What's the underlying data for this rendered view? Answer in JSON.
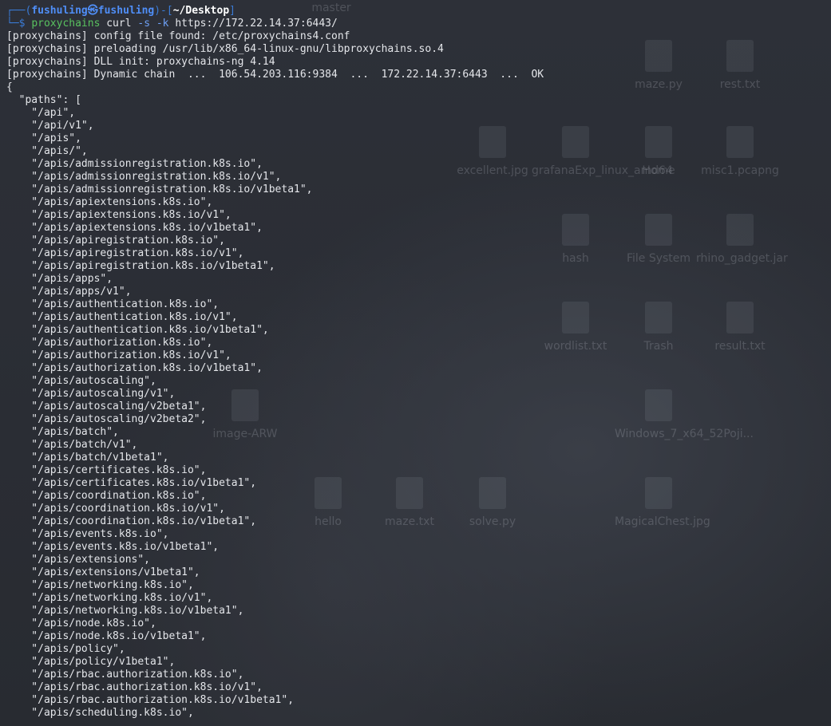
{
  "prompt": {
    "frame_open": "┌──(",
    "user": "fushuling",
    "at_symbol": "㉿",
    "host": "fushuling",
    "frame_mid": ")-[",
    "cwd": "~/Desktop",
    "frame_close": "]",
    "frame_cmd": "└─$ ",
    "command": "proxychains",
    "args_pre": " curl ",
    "flags": "-s -k",
    "url": " https://172.22.14.37:6443/"
  },
  "output_lines": [
    "[proxychains] config file found: /etc/proxychains4.conf",
    "[proxychains] preloading /usr/lib/x86_64-linux-gnu/libproxychains.so.4",
    "[proxychains] DLL init: proxychains-ng 4.14",
    "[proxychains] Dynamic chain  ...  106.54.203.116:9384  ...  172.22.14.37:6443  ...  OK",
    "{",
    "  \"paths\": [",
    "    \"/api\",",
    "    \"/api/v1\",",
    "    \"/apis\",",
    "    \"/apis/\",",
    "    \"/apis/admissionregistration.k8s.io\",",
    "    \"/apis/admissionregistration.k8s.io/v1\",",
    "    \"/apis/admissionregistration.k8s.io/v1beta1\",",
    "    \"/apis/apiextensions.k8s.io\",",
    "    \"/apis/apiextensions.k8s.io/v1\",",
    "    \"/apis/apiextensions.k8s.io/v1beta1\",",
    "    \"/apis/apiregistration.k8s.io\",",
    "    \"/apis/apiregistration.k8s.io/v1\",",
    "    \"/apis/apiregistration.k8s.io/v1beta1\",",
    "    \"/apis/apps\",",
    "    \"/apis/apps/v1\",",
    "    \"/apis/authentication.k8s.io\",",
    "    \"/apis/authentication.k8s.io/v1\",",
    "    \"/apis/authentication.k8s.io/v1beta1\",",
    "    \"/apis/authorization.k8s.io\",",
    "    \"/apis/authorization.k8s.io/v1\",",
    "    \"/apis/authorization.k8s.io/v1beta1\",",
    "    \"/apis/autoscaling\",",
    "    \"/apis/autoscaling/v1\",",
    "    \"/apis/autoscaling/v2beta1\",",
    "    \"/apis/autoscaling/v2beta2\",",
    "    \"/apis/batch\",",
    "    \"/apis/batch/v1\",",
    "    \"/apis/batch/v1beta1\",",
    "    \"/apis/certificates.k8s.io\",",
    "    \"/apis/certificates.k8s.io/v1beta1\",",
    "    \"/apis/coordination.k8s.io\",",
    "    \"/apis/coordination.k8s.io/v1\",",
    "    \"/apis/coordination.k8s.io/v1beta1\",",
    "    \"/apis/events.k8s.io\",",
    "    \"/apis/events.k8s.io/v1beta1\",",
    "    \"/apis/extensions\",",
    "    \"/apis/extensions/v1beta1\",",
    "    \"/apis/networking.k8s.io\",",
    "    \"/apis/networking.k8s.io/v1\",",
    "    \"/apis/networking.k8s.io/v1beta1\",",
    "    \"/apis/node.k8s.io\",",
    "    \"/apis/node.k8s.io/v1beta1\",",
    "    \"/apis/policy\",",
    "    \"/apis/policy/v1beta1\",",
    "    \"/apis/rbac.authorization.k8s.io\",",
    "    \"/apis/rbac.authorization.k8s.io/v1\",",
    "    \"/apis/rbac.authorization.k8s.io/v1beta1\",",
    "    \"/apis/scheduling.k8s.io\","
  ],
  "desktop_icons": [
    "master",
    "maze.py",
    "rest.txt",
    "excellent.jpg",
    "grafanaExp_linux_amd64",
    "Home",
    "misc1.pcapng",
    "hash",
    "File System",
    "rhino_gadget.jar",
    "wordlist.txt",
    "Trash",
    "result.txt",
    "image-ARW",
    "Windows_7_x64_52Poji...",
    "hello",
    "maze.txt",
    "solve.py",
    "MagicalChest.jpg"
  ],
  "colors": {
    "terminal_bg": "#2b2e35",
    "frame": "#3a7bd5",
    "user": "#4f8ef7",
    "command": "#59c25f",
    "text": "#e4e6ea"
  }
}
